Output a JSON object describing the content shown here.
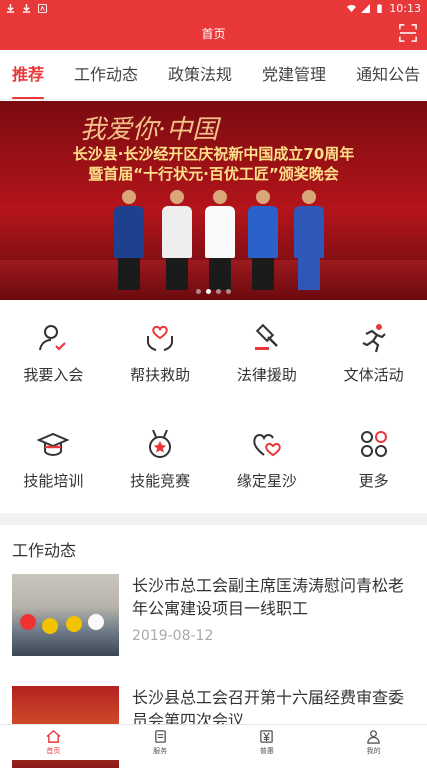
{
  "status": {
    "time": "10:13"
  },
  "header": {
    "title": "首页"
  },
  "tabs": [
    {
      "label": "推荐",
      "active": true
    },
    {
      "label": "工作动态"
    },
    {
      "label": "政策法规"
    },
    {
      "label": "党建管理"
    },
    {
      "label": "通知公告"
    }
  ],
  "banner": {
    "slogan": "我爱你·中国",
    "line1": "长沙县·长沙经开区庆祝新中国成立70周年",
    "line2": "暨首届“十行状元·百优工匠”颁奖晚会"
  },
  "services": [
    {
      "label": "我要入会",
      "icon": "person-check-icon"
    },
    {
      "label": "帮扶救助",
      "icon": "heart-hands-icon"
    },
    {
      "label": "法律援助",
      "icon": "gavel-icon"
    },
    {
      "label": "文体活动",
      "icon": "running-icon"
    },
    {
      "label": "技能培训",
      "icon": "graduation-cap-icon"
    },
    {
      "label": "技能竞赛",
      "icon": "medal-icon"
    },
    {
      "label": "缘定星沙",
      "icon": "two-hearts-icon"
    },
    {
      "label": "更多",
      "icon": "grid-more-icon"
    }
  ],
  "section": {
    "title": "工作动态"
  },
  "news": [
    {
      "title": "长沙市总工会副主席匡涛涛慰问青松老年公寓建设项目一线职工",
      "date": "2019-08-12"
    },
    {
      "title": "长沙县总工会召开第十六届经费审查委员会第四次会议",
      "date": ""
    }
  ],
  "bottom_nav": [
    {
      "label": "首页",
      "icon": "home-icon",
      "active": true
    },
    {
      "label": "服务",
      "icon": "service-icon"
    },
    {
      "label": "普惠",
      "icon": "yen-card-icon"
    },
    {
      "label": "我的",
      "icon": "user-icon"
    }
  ],
  "colors": {
    "accent": "#e8383a"
  }
}
